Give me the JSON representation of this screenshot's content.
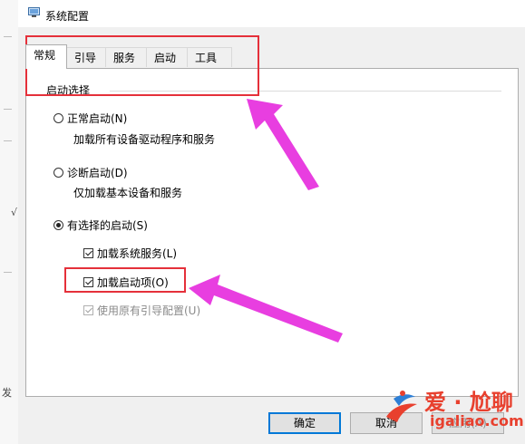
{
  "window": {
    "title": "系统配置"
  },
  "tabs": [
    {
      "label": "常规",
      "active": true
    },
    {
      "label": "引导",
      "active": false
    },
    {
      "label": "服务",
      "active": false
    },
    {
      "label": "启动",
      "active": false
    },
    {
      "label": "工具",
      "active": false
    }
  ],
  "startup": {
    "group_label": "启动选择",
    "normal": {
      "label": "正常启动(N)",
      "desc": "加载所有设备驱动程序和服务",
      "selected": false
    },
    "diagnostic": {
      "label": "诊断启动(D)",
      "desc": "仅加载基本设备和服务",
      "selected": false
    },
    "selective": {
      "label": "有选择的启动(S)",
      "selected": true
    },
    "options": [
      {
        "label": "加载系统服务(L)",
        "checked": true,
        "enabled": true
      },
      {
        "label": "加载启动项(O)",
        "checked": true,
        "enabled": true
      },
      {
        "label": "使用原有引导配置(U)",
        "checked": true,
        "enabled": false
      }
    ]
  },
  "buttons": {
    "ok": "确定",
    "cancel": "取消",
    "apply": "应用(A)"
  },
  "annotations": {
    "highlight_color": "#e5303a",
    "arrow_color": "#e83ee0"
  },
  "watermark": {
    "brand": "爱 · 尬聊",
    "url": "igaliao.com",
    "color": "#e8402e"
  },
  "background_text": {
    "left_edge_glyph": "发",
    "left_edge_mark": "√"
  }
}
